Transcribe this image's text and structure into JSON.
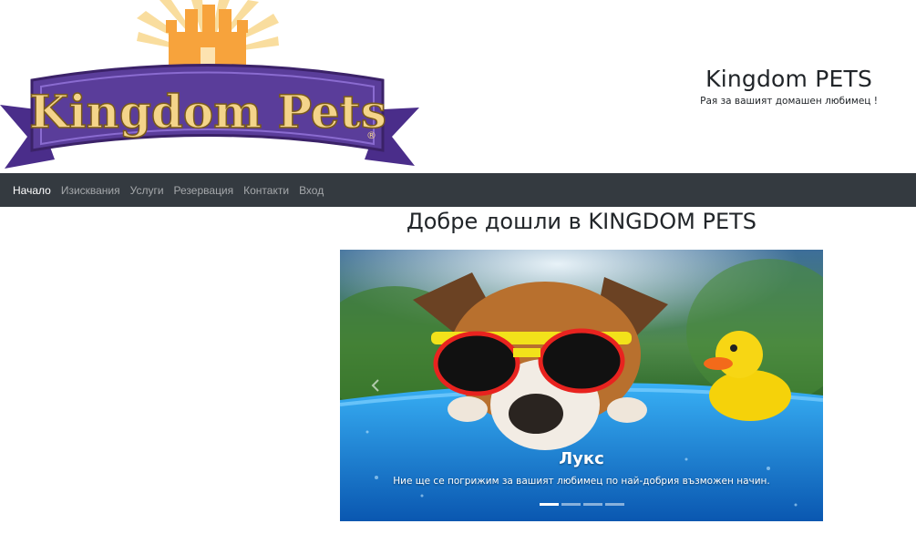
{
  "header": {
    "logo_text": "Kingdom Pets",
    "brand_title": "Kingdom PETS",
    "brand_subtitle": "Рая за вашият домашен любимец !"
  },
  "nav": {
    "items": [
      {
        "label": "Начало",
        "active": true
      },
      {
        "label": "Изисквания",
        "active": false
      },
      {
        "label": "Услуги",
        "active": false
      },
      {
        "label": "Резервация",
        "active": false
      },
      {
        "label": "Контакти",
        "active": false
      },
      {
        "label": "Вход",
        "active": false
      }
    ]
  },
  "main": {
    "title": "Добре дошли в KINGDOM PETS",
    "carousel": {
      "slide_title": "Лукс",
      "slide_text": "Ние ще се погрижим за вашият любимец по най-добрия възможен начин.",
      "slide_count": 4,
      "active_index": 0
    }
  },
  "colors": {
    "navbar": "#343a40",
    "banner_purple": "#5a3d9a",
    "logo_text": "#f4d48a",
    "castle_orange": "#f7a33c",
    "pool_blue": "#1a8fe0"
  }
}
